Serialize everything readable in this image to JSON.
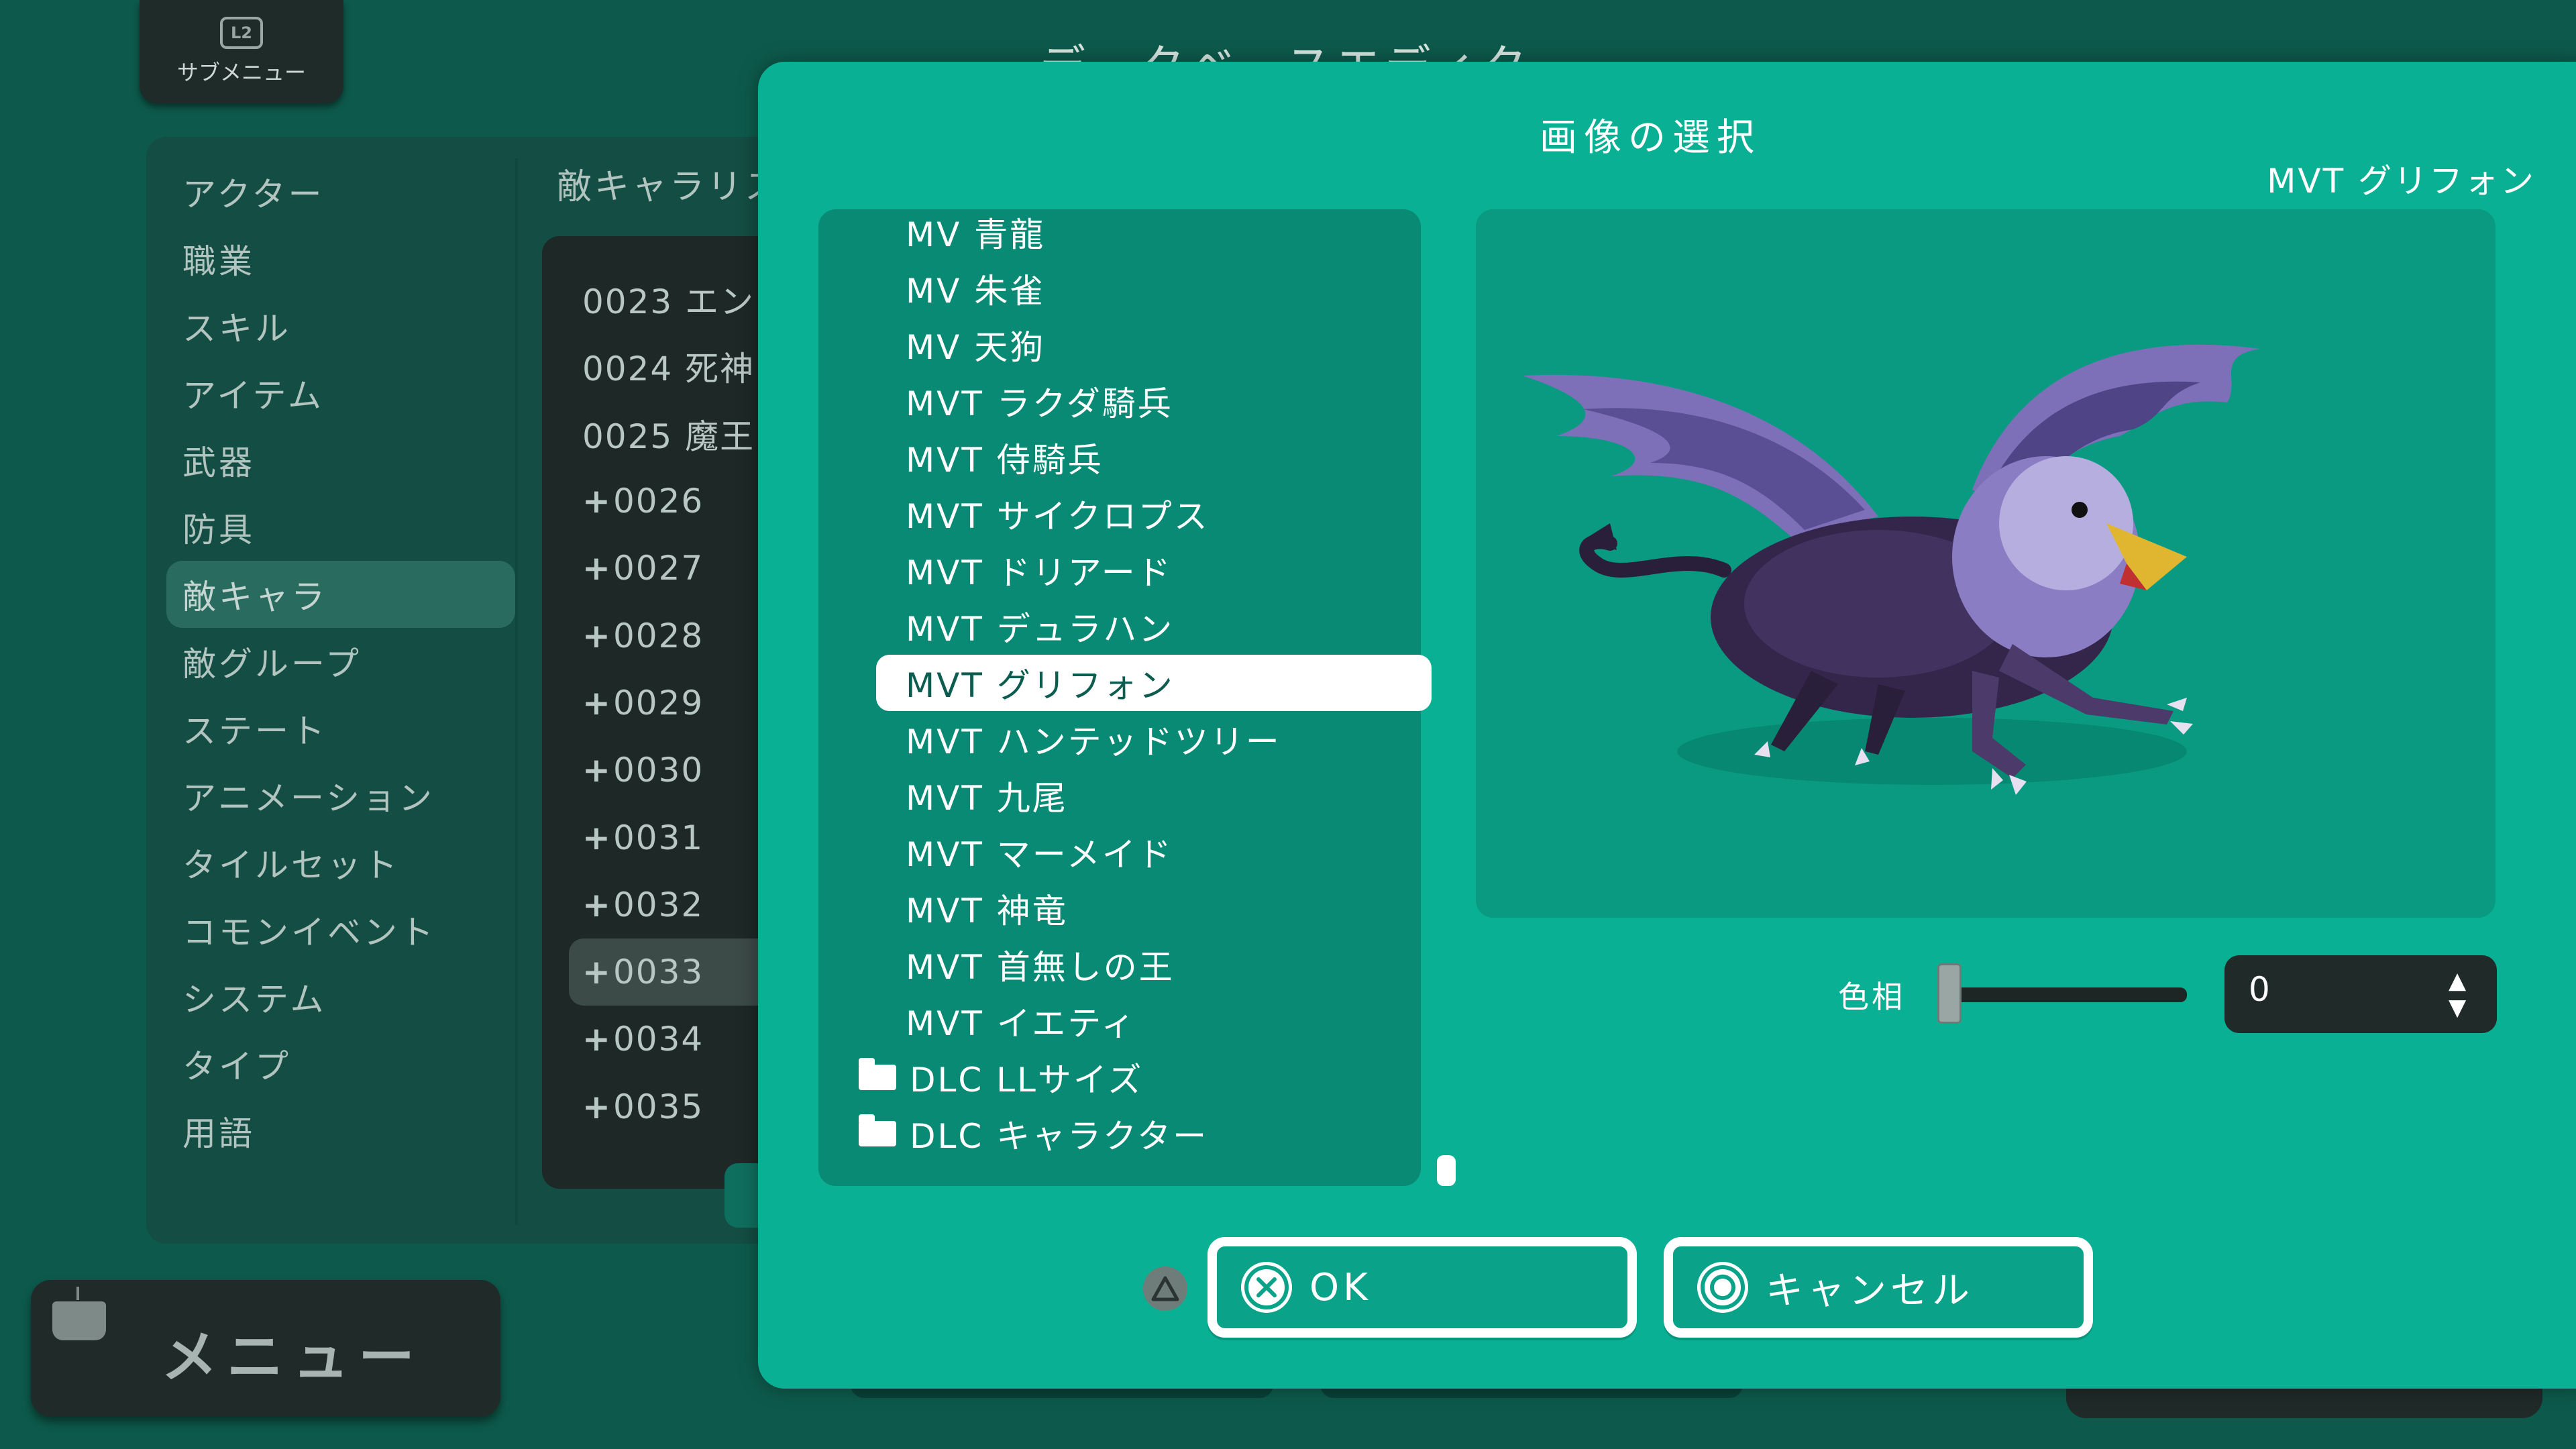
{
  "submenu": {
    "badge": "L2",
    "label": "サブメニュー"
  },
  "background_title": "データベースエディタ",
  "categories": {
    "selected_index": 6,
    "items": [
      "アクター",
      "職業",
      "スキル",
      "アイテム",
      "武器",
      "防具",
      "敵キャラ",
      "敵グループ",
      "ステート",
      "アニメーション",
      "タイルセット",
      "コモンイベント",
      "システム",
      "タイプ",
      "用語"
    ]
  },
  "enemy_list": {
    "header": "敵キャラリスト",
    "selected_index": 10,
    "items": [
      {
        "prefix": "",
        "label": "0023 エン"
      },
      {
        "prefix": "",
        "label": "0024 死神"
      },
      {
        "prefix": "",
        "label": "0025 魔王"
      },
      {
        "prefix": "+",
        "label": "0026"
      },
      {
        "prefix": "+",
        "label": "0027"
      },
      {
        "prefix": "+",
        "label": "0028"
      },
      {
        "prefix": "+",
        "label": "0029"
      },
      {
        "prefix": "+",
        "label": "0030"
      },
      {
        "prefix": "+",
        "label": "0031"
      },
      {
        "prefix": "+",
        "label": "0032"
      },
      {
        "prefix": "+",
        "label": "0033"
      },
      {
        "prefix": "+",
        "label": "0034"
      },
      {
        "prefix": "+",
        "label": "0035"
      }
    ]
  },
  "menu": {
    "label": "メニュー"
  },
  "dialog": {
    "title": "画像の選択",
    "selected_image_name": "MVT グリフォン",
    "file_list": {
      "selected_index": 8,
      "items": [
        {
          "type": "file",
          "label": "MV 青龍"
        },
        {
          "type": "file",
          "label": "MV 朱雀"
        },
        {
          "type": "file",
          "label": "MV 天狗"
        },
        {
          "type": "file",
          "label": "MVT ラクダ騎兵"
        },
        {
          "type": "file",
          "label": "MVT 侍騎兵"
        },
        {
          "type": "file",
          "label": "MVT サイクロプス"
        },
        {
          "type": "file",
          "label": "MVT ドリアード"
        },
        {
          "type": "file",
          "label": "MVT デュラハン"
        },
        {
          "type": "file",
          "label": "MVT グリフォン"
        },
        {
          "type": "file",
          "label": "MVT ハンテッドツリー"
        },
        {
          "type": "file",
          "label": "MVT 九尾"
        },
        {
          "type": "file",
          "label": "MVT マーメイド"
        },
        {
          "type": "file",
          "label": "MVT 神竜"
        },
        {
          "type": "file",
          "label": "MVT 首無しの王"
        },
        {
          "type": "file",
          "label": "MVT イエティ"
        },
        {
          "type": "folder",
          "label": "DLC LLサイズ"
        },
        {
          "type": "folder",
          "label": "DLC キャラクター"
        }
      ]
    },
    "hue": {
      "label": "色相",
      "value": "0",
      "slider_fraction": 0
    },
    "ok_label": "OK",
    "cancel_label": "キャンセル"
  },
  "colors": {
    "background": "#0d5a4c",
    "dialog": "#0ab094",
    "selection": "#ffffff",
    "dark_panel": "#1f2a29"
  },
  "icons": [
    "l2-button-icon",
    "menu-icon",
    "plus-icon",
    "folder-icon",
    "triangle-button-icon",
    "cross-button-icon",
    "circle-button-icon",
    "spinner-up-icon",
    "spinner-down-icon"
  ]
}
